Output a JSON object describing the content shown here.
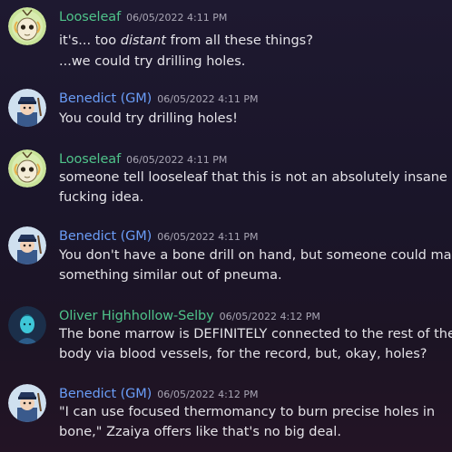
{
  "messages": [
    {
      "author": "Looseleaf",
      "author_color": "#4fc38a",
      "avatar_icon": "moth-avatar-icon",
      "timestamp": "06/05/2022 4:11 PM",
      "lines": [
        {
          "pre": "it's... too ",
          "em": "distant",
          "post": " from all these things?"
        },
        {
          "text": "...we could try drilling holes."
        }
      ]
    },
    {
      "author": "Benedict (GM)",
      "author_color": "#6a9df7",
      "avatar_icon": "gm-avatar-icon",
      "timestamp": "06/05/2022 4:11 PM",
      "lines": [
        {
          "text": "You could try drilling holes!"
        }
      ]
    },
    {
      "author": "Looseleaf",
      "author_color": "#4fc38a",
      "avatar_icon": "moth-avatar-icon",
      "timestamp": "06/05/2022 4:11 PM",
      "lines": [
        {
          "text": "someone tell looseleaf that this is not an absolutely insane"
        },
        {
          "text": "fucking idea."
        }
      ]
    },
    {
      "author": "Benedict (GM)",
      "author_color": "#6a9df7",
      "avatar_icon": "gm-avatar-icon",
      "timestamp": "06/05/2022 4:11 PM",
      "lines": [
        {
          "text": "You don't have a bone drill on hand, but someone could make"
        },
        {
          "text": "something similar out of pneuma."
        }
      ]
    },
    {
      "author": "Oliver Highhollow-Selby",
      "author_color": "#4fc38a",
      "avatar_icon": "oliver-avatar-icon",
      "timestamp": "06/05/2022 4:12 PM",
      "lines": [
        {
          "text": "The bone marrow is DEFINITELY connected to the rest of the"
        },
        {
          "text": "body via blood vessels, for the record, but, okay, holes?"
        }
      ]
    },
    {
      "author": "Benedict (GM)",
      "author_color": "#6a9df7",
      "avatar_icon": "gm-avatar-icon",
      "timestamp": "06/05/2022 4:12 PM",
      "lines": [
        {
          "text": "\"I can use focused thermomancy to burn precise holes in"
        },
        {
          "text": "bone,\" Zzaiya offers like that's no big deal."
        }
      ]
    }
  ]
}
